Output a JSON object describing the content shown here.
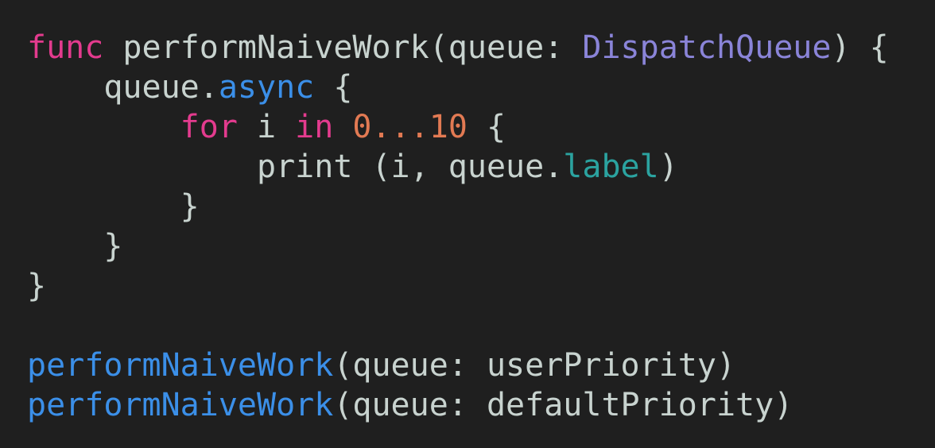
{
  "theme": {
    "background": "#1f1f1f",
    "plain": "#c8d3cf",
    "keyword": "#e33b8e",
    "type": "#8a84d8",
    "method": "#3b8fe8",
    "number": "#e27a53",
    "property": "#2ba3a0"
  },
  "lines": [
    {
      "indent": "",
      "tokens": [
        {
          "text": "func",
          "kind": "keyword"
        },
        {
          "text": " performNaiveWork(queue: ",
          "kind": "plain"
        },
        {
          "text": "DispatchQueue",
          "kind": "type"
        },
        {
          "text": ") {",
          "kind": "plain"
        }
      ]
    },
    {
      "indent": "    ",
      "tokens": [
        {
          "text": "queue.",
          "kind": "plain"
        },
        {
          "text": "async",
          "kind": "method"
        },
        {
          "text": " {",
          "kind": "plain"
        }
      ]
    },
    {
      "indent": "        ",
      "tokens": [
        {
          "text": "for",
          "kind": "keyword"
        },
        {
          "text": " i ",
          "kind": "plain"
        },
        {
          "text": "in",
          "kind": "keyword"
        },
        {
          "text": " ",
          "kind": "plain"
        },
        {
          "text": "0...10",
          "kind": "number"
        },
        {
          "text": " {",
          "kind": "plain"
        }
      ]
    },
    {
      "indent": "            ",
      "tokens": [
        {
          "text": "print (i, queue.",
          "kind": "plain"
        },
        {
          "text": "label",
          "kind": "property"
        },
        {
          "text": ")",
          "kind": "plain"
        }
      ]
    },
    {
      "indent": "        ",
      "tokens": [
        {
          "text": "}",
          "kind": "plain"
        }
      ]
    },
    {
      "indent": "    ",
      "tokens": [
        {
          "text": "}",
          "kind": "plain"
        }
      ]
    },
    {
      "indent": "",
      "tokens": [
        {
          "text": "}",
          "kind": "plain"
        }
      ]
    },
    {
      "indent": "",
      "tokens": []
    },
    {
      "indent": "",
      "tokens": [
        {
          "text": "performNaiveWork",
          "kind": "method"
        },
        {
          "text": "(queue: userPriority)",
          "kind": "plain"
        }
      ]
    },
    {
      "indent": "",
      "tokens": [
        {
          "text": "performNaiveWork",
          "kind": "method"
        },
        {
          "text": "(queue: defaultPriority)",
          "kind": "plain"
        }
      ]
    }
  ]
}
